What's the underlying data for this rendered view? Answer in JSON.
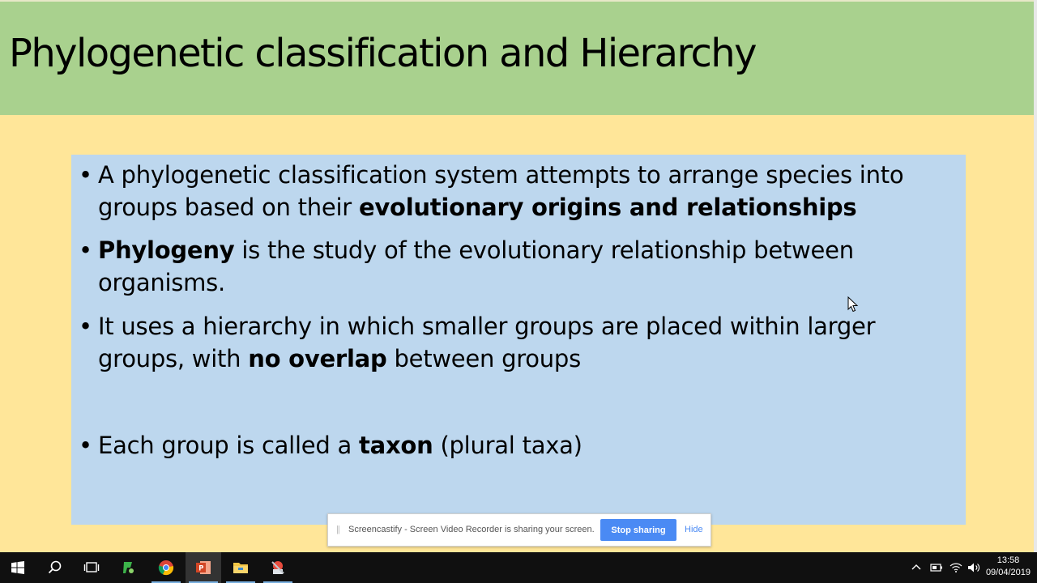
{
  "slide": {
    "title": "Phylogenetic classification and Hierarchy",
    "bullets": [
      {
        "parts": [
          {
            "text": "A phylogenetic classification system attempts to arrange species into groups based on their ",
            "bold": false
          },
          {
            "text": "evolutionary origins and relationships",
            "bold": true
          }
        ]
      },
      {
        "parts": [
          {
            "text": "Phylogeny",
            "bold": true
          },
          {
            "text": " is the study of the evolutionary relationship between organisms.",
            "bold": false
          }
        ]
      },
      {
        "parts": [
          {
            "text": "It uses a hierarchy in which smaller groups are placed within larger groups, with ",
            "bold": false
          },
          {
            "text": "no overlap",
            "bold": true
          },
          {
            "text": " between groups",
            "bold": false
          }
        ]
      },
      {
        "parts": [
          {
            "text": "Each group is called a ",
            "bold": false
          },
          {
            "text": "taxon",
            "bold": true
          },
          {
            "text": " (plural taxa)",
            "bold": false
          }
        ]
      }
    ],
    "bullet_char": "•",
    "colors": {
      "title_band": "#a9d18e",
      "background": "#ffe699",
      "content_box": "#bdd7ee"
    }
  },
  "screen_share": {
    "message": "Screencastify - Screen Video Recorder is sharing your screen.",
    "stop_label": "Stop sharing",
    "hide_label": "Hide"
  },
  "taskbar": {
    "apps": [
      "start-icon",
      "search-icon",
      "task-view-icon",
      "app-green-icon",
      "chrome-icon",
      "powerpoint-icon",
      "file-explorer-icon",
      "app-misc-icon"
    ],
    "active_app": "powerpoint-icon",
    "time": "13:58",
    "date": "09/04/2019"
  }
}
